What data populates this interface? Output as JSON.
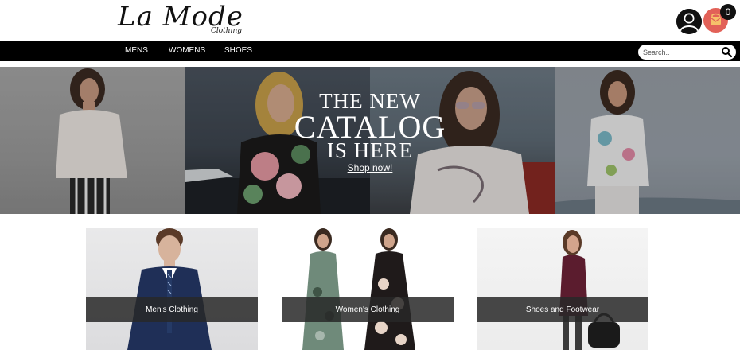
{
  "brand": {
    "name": "La Mode",
    "tagline": "Clothing"
  },
  "cart": {
    "count": "0",
    "color": "#e26158"
  },
  "nav": {
    "items": [
      "MENS",
      "WOMENS",
      "SHOES"
    ]
  },
  "search": {
    "placeholder": "Search..",
    "icon": "search-icon"
  },
  "hero": {
    "line1": "THE NEW",
    "line2": "CATALOG",
    "line3": "IS HERE",
    "cta": "Shop now!"
  },
  "categories": [
    {
      "label": "Men's Clothing"
    },
    {
      "label": "Women's Clothing"
    },
    {
      "label": "Shoes and Footwear"
    }
  ],
  "icons": {
    "account": "user-icon",
    "cart": "cart-icon"
  }
}
